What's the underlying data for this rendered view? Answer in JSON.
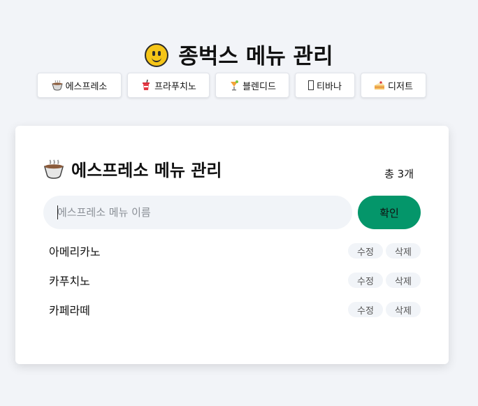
{
  "header": {
    "title": "종벅스 메뉴 관리",
    "icon": "smiling-face-icon"
  },
  "nav": [
    {
      "label": "에스프레소",
      "icon": "hot-coffee-icon"
    },
    {
      "label": "프라푸치노",
      "icon": "cup-with-straw-icon"
    },
    {
      "label": "블렌디드",
      "icon": "tropical-drink-icon"
    },
    {
      "label": "티바나",
      "icon": "missing-glyph-icon"
    },
    {
      "label": "디저트",
      "icon": "cake-slice-icon"
    }
  ],
  "card": {
    "title": "에스프레소 메뉴 관리",
    "title_icon": "hot-coffee-icon",
    "total": "총 3개",
    "input_placeholder": "에스프레소 메뉴 이름",
    "input_value": "",
    "submit_label": "확인",
    "submit_color": "#04966a",
    "items": [
      {
        "name": "아메리카노",
        "edit_label": "수정",
        "delete_label": "삭제"
      },
      {
        "name": "카푸치노",
        "edit_label": "수정",
        "delete_label": "삭제"
      },
      {
        "name": "카페라떼",
        "edit_label": "수정",
        "delete_label": "삭제"
      }
    ]
  }
}
